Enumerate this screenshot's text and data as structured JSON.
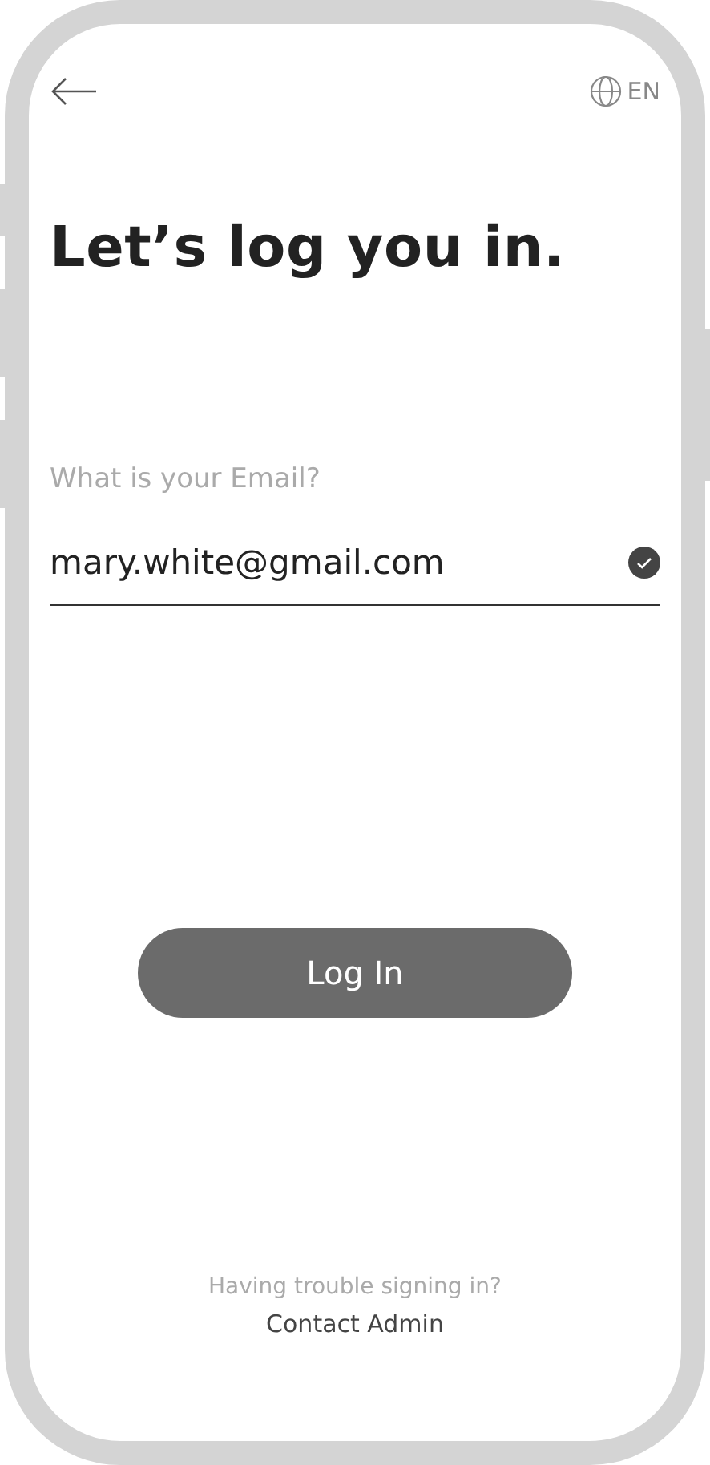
{
  "header": {
    "language": "EN"
  },
  "title": "Let’s log you in.",
  "email_field": {
    "label": "What is your Email?",
    "value": "mary.white@gmail.com",
    "valid": true
  },
  "login_button": "Log In",
  "help": {
    "text": "Having trouble signing in?",
    "link": "Contact Admin"
  }
}
